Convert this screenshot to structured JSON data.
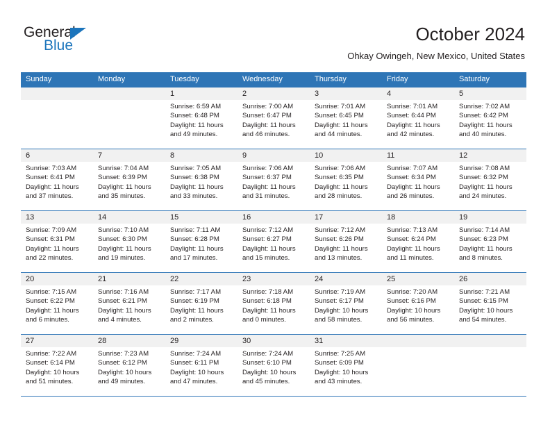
{
  "brand": {
    "name_top": "General",
    "name_bottom": "Blue",
    "color_blue": "#1c75bc",
    "color_dark": "#231f20"
  },
  "header": {
    "title": "October 2024",
    "subtitle": "Ohkay Owingeh, New Mexico, United States"
  },
  "theme": {
    "header_blue": "#2e75b6",
    "day_strip_gray": "#f1f1f1",
    "text": "#231f20"
  },
  "columns": [
    "Sunday",
    "Monday",
    "Tuesday",
    "Wednesday",
    "Thursday",
    "Friday",
    "Saturday"
  ],
  "weeks": [
    [
      {
        "day": "",
        "sunrise": "",
        "sunset": "",
        "daylight1": "",
        "daylight2": ""
      },
      {
        "day": "",
        "sunrise": "",
        "sunset": "",
        "daylight1": "",
        "daylight2": ""
      },
      {
        "day": "1",
        "sunrise": "Sunrise: 6:59 AM",
        "sunset": "Sunset: 6:48 PM",
        "daylight1": "Daylight: 11 hours",
        "daylight2": "and 49 minutes."
      },
      {
        "day": "2",
        "sunrise": "Sunrise: 7:00 AM",
        "sunset": "Sunset: 6:47 PM",
        "daylight1": "Daylight: 11 hours",
        "daylight2": "and 46 minutes."
      },
      {
        "day": "3",
        "sunrise": "Sunrise: 7:01 AM",
        "sunset": "Sunset: 6:45 PM",
        "daylight1": "Daylight: 11 hours",
        "daylight2": "and 44 minutes."
      },
      {
        "day": "4",
        "sunrise": "Sunrise: 7:01 AM",
        "sunset": "Sunset: 6:44 PM",
        "daylight1": "Daylight: 11 hours",
        "daylight2": "and 42 minutes."
      },
      {
        "day": "5",
        "sunrise": "Sunrise: 7:02 AM",
        "sunset": "Sunset: 6:42 PM",
        "daylight1": "Daylight: 11 hours",
        "daylight2": "and 40 minutes."
      }
    ],
    [
      {
        "day": "6",
        "sunrise": "Sunrise: 7:03 AM",
        "sunset": "Sunset: 6:41 PM",
        "daylight1": "Daylight: 11 hours",
        "daylight2": "and 37 minutes."
      },
      {
        "day": "7",
        "sunrise": "Sunrise: 7:04 AM",
        "sunset": "Sunset: 6:39 PM",
        "daylight1": "Daylight: 11 hours",
        "daylight2": "and 35 minutes."
      },
      {
        "day": "8",
        "sunrise": "Sunrise: 7:05 AM",
        "sunset": "Sunset: 6:38 PM",
        "daylight1": "Daylight: 11 hours",
        "daylight2": "and 33 minutes."
      },
      {
        "day": "9",
        "sunrise": "Sunrise: 7:06 AM",
        "sunset": "Sunset: 6:37 PM",
        "daylight1": "Daylight: 11 hours",
        "daylight2": "and 31 minutes."
      },
      {
        "day": "10",
        "sunrise": "Sunrise: 7:06 AM",
        "sunset": "Sunset: 6:35 PM",
        "daylight1": "Daylight: 11 hours",
        "daylight2": "and 28 minutes."
      },
      {
        "day": "11",
        "sunrise": "Sunrise: 7:07 AM",
        "sunset": "Sunset: 6:34 PM",
        "daylight1": "Daylight: 11 hours",
        "daylight2": "and 26 minutes."
      },
      {
        "day": "12",
        "sunrise": "Sunrise: 7:08 AM",
        "sunset": "Sunset: 6:32 PM",
        "daylight1": "Daylight: 11 hours",
        "daylight2": "and 24 minutes."
      }
    ],
    [
      {
        "day": "13",
        "sunrise": "Sunrise: 7:09 AM",
        "sunset": "Sunset: 6:31 PM",
        "daylight1": "Daylight: 11 hours",
        "daylight2": "and 22 minutes."
      },
      {
        "day": "14",
        "sunrise": "Sunrise: 7:10 AM",
        "sunset": "Sunset: 6:30 PM",
        "daylight1": "Daylight: 11 hours",
        "daylight2": "and 19 minutes."
      },
      {
        "day": "15",
        "sunrise": "Sunrise: 7:11 AM",
        "sunset": "Sunset: 6:28 PM",
        "daylight1": "Daylight: 11 hours",
        "daylight2": "and 17 minutes."
      },
      {
        "day": "16",
        "sunrise": "Sunrise: 7:12 AM",
        "sunset": "Sunset: 6:27 PM",
        "daylight1": "Daylight: 11 hours",
        "daylight2": "and 15 minutes."
      },
      {
        "day": "17",
        "sunrise": "Sunrise: 7:12 AM",
        "sunset": "Sunset: 6:26 PM",
        "daylight1": "Daylight: 11 hours",
        "daylight2": "and 13 minutes."
      },
      {
        "day": "18",
        "sunrise": "Sunrise: 7:13 AM",
        "sunset": "Sunset: 6:24 PM",
        "daylight1": "Daylight: 11 hours",
        "daylight2": "and 11 minutes."
      },
      {
        "day": "19",
        "sunrise": "Sunrise: 7:14 AM",
        "sunset": "Sunset: 6:23 PM",
        "daylight1": "Daylight: 11 hours",
        "daylight2": "and 8 minutes."
      }
    ],
    [
      {
        "day": "20",
        "sunrise": "Sunrise: 7:15 AM",
        "sunset": "Sunset: 6:22 PM",
        "daylight1": "Daylight: 11 hours",
        "daylight2": "and 6 minutes."
      },
      {
        "day": "21",
        "sunrise": "Sunrise: 7:16 AM",
        "sunset": "Sunset: 6:21 PM",
        "daylight1": "Daylight: 11 hours",
        "daylight2": "and 4 minutes."
      },
      {
        "day": "22",
        "sunrise": "Sunrise: 7:17 AM",
        "sunset": "Sunset: 6:19 PM",
        "daylight1": "Daylight: 11 hours",
        "daylight2": "and 2 minutes."
      },
      {
        "day": "23",
        "sunrise": "Sunrise: 7:18 AM",
        "sunset": "Sunset: 6:18 PM",
        "daylight1": "Daylight: 11 hours",
        "daylight2": "and 0 minutes."
      },
      {
        "day": "24",
        "sunrise": "Sunrise: 7:19 AM",
        "sunset": "Sunset: 6:17 PM",
        "daylight1": "Daylight: 10 hours",
        "daylight2": "and 58 minutes."
      },
      {
        "day": "25",
        "sunrise": "Sunrise: 7:20 AM",
        "sunset": "Sunset: 6:16 PM",
        "daylight1": "Daylight: 10 hours",
        "daylight2": "and 56 minutes."
      },
      {
        "day": "26",
        "sunrise": "Sunrise: 7:21 AM",
        "sunset": "Sunset: 6:15 PM",
        "daylight1": "Daylight: 10 hours",
        "daylight2": "and 54 minutes."
      }
    ],
    [
      {
        "day": "27",
        "sunrise": "Sunrise: 7:22 AM",
        "sunset": "Sunset: 6:14 PM",
        "daylight1": "Daylight: 10 hours",
        "daylight2": "and 51 minutes."
      },
      {
        "day": "28",
        "sunrise": "Sunrise: 7:23 AM",
        "sunset": "Sunset: 6:12 PM",
        "daylight1": "Daylight: 10 hours",
        "daylight2": "and 49 minutes."
      },
      {
        "day": "29",
        "sunrise": "Sunrise: 7:24 AM",
        "sunset": "Sunset: 6:11 PM",
        "daylight1": "Daylight: 10 hours",
        "daylight2": "and 47 minutes."
      },
      {
        "day": "30",
        "sunrise": "Sunrise: 7:24 AM",
        "sunset": "Sunset: 6:10 PM",
        "daylight1": "Daylight: 10 hours",
        "daylight2": "and 45 minutes."
      },
      {
        "day": "31",
        "sunrise": "Sunrise: 7:25 AM",
        "sunset": "Sunset: 6:09 PM",
        "daylight1": "Daylight: 10 hours",
        "daylight2": "and 43 minutes."
      },
      {
        "day": "",
        "sunrise": "",
        "sunset": "",
        "daylight1": "",
        "daylight2": ""
      },
      {
        "day": "",
        "sunrise": "",
        "sunset": "",
        "daylight1": "",
        "daylight2": ""
      }
    ]
  ]
}
